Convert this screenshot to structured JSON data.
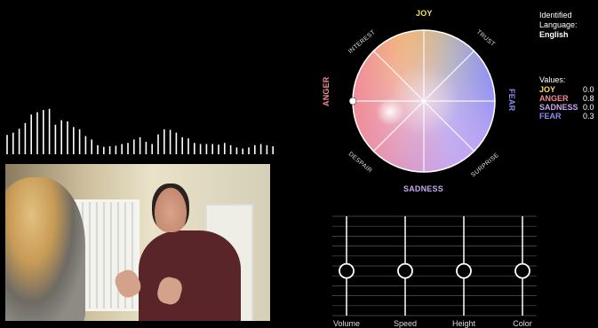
{
  "waveform": {
    "bars": [
      0.34,
      0.38,
      0.45,
      0.55,
      0.7,
      0.74,
      0.78,
      0.8,
      0.52,
      0.6,
      0.58,
      0.48,
      0.44,
      0.32,
      0.26,
      0.16,
      0.13,
      0.14,
      0.15,
      0.18,
      0.2,
      0.26,
      0.3,
      0.22,
      0.18,
      0.35,
      0.44,
      0.43,
      0.38,
      0.3,
      0.28,
      0.2,
      0.18,
      0.18,
      0.18,
      0.17,
      0.2,
      0.16,
      0.12,
      0.1,
      0.12,
      0.16,
      0.18,
      0.16,
      0.14
    ]
  },
  "wheel": {
    "labels": {
      "joy": "JOY",
      "anger": "ANGER",
      "fear": "FEAR",
      "sadness": "SADNESS",
      "interest": "INTEREST",
      "trust": "TRUST",
      "despair": "DESPAIR",
      "surprise": "SURPRISE"
    },
    "colors": {
      "joy": "#f3e05a",
      "anger": "#f08a96",
      "fear": "#8a8ef5",
      "sadness": "#c7a7f0"
    }
  },
  "info": {
    "identified_label_1": "Identified",
    "identified_label_2": "Language:",
    "language": "English",
    "values_heading": "Values:",
    "values": [
      {
        "name": "JOY",
        "value": "0.0",
        "color": "#f3e05a"
      },
      {
        "name": "ANGER",
        "value": "0.8",
        "color": "#f08a96"
      },
      {
        "name": "SADNESS",
        "value": "0.0",
        "color": "#c7a7f0"
      },
      {
        "name": "FEAR",
        "value": "0.3",
        "color": "#8a8ef5"
      }
    ]
  },
  "sliders": {
    "items": [
      {
        "label": "Volume",
        "level": 0.45
      },
      {
        "label": "Speed",
        "level": 0.45
      },
      {
        "label": "Height",
        "level": 0.45
      },
      {
        "label": "Color",
        "level": 0.45
      }
    ]
  }
}
